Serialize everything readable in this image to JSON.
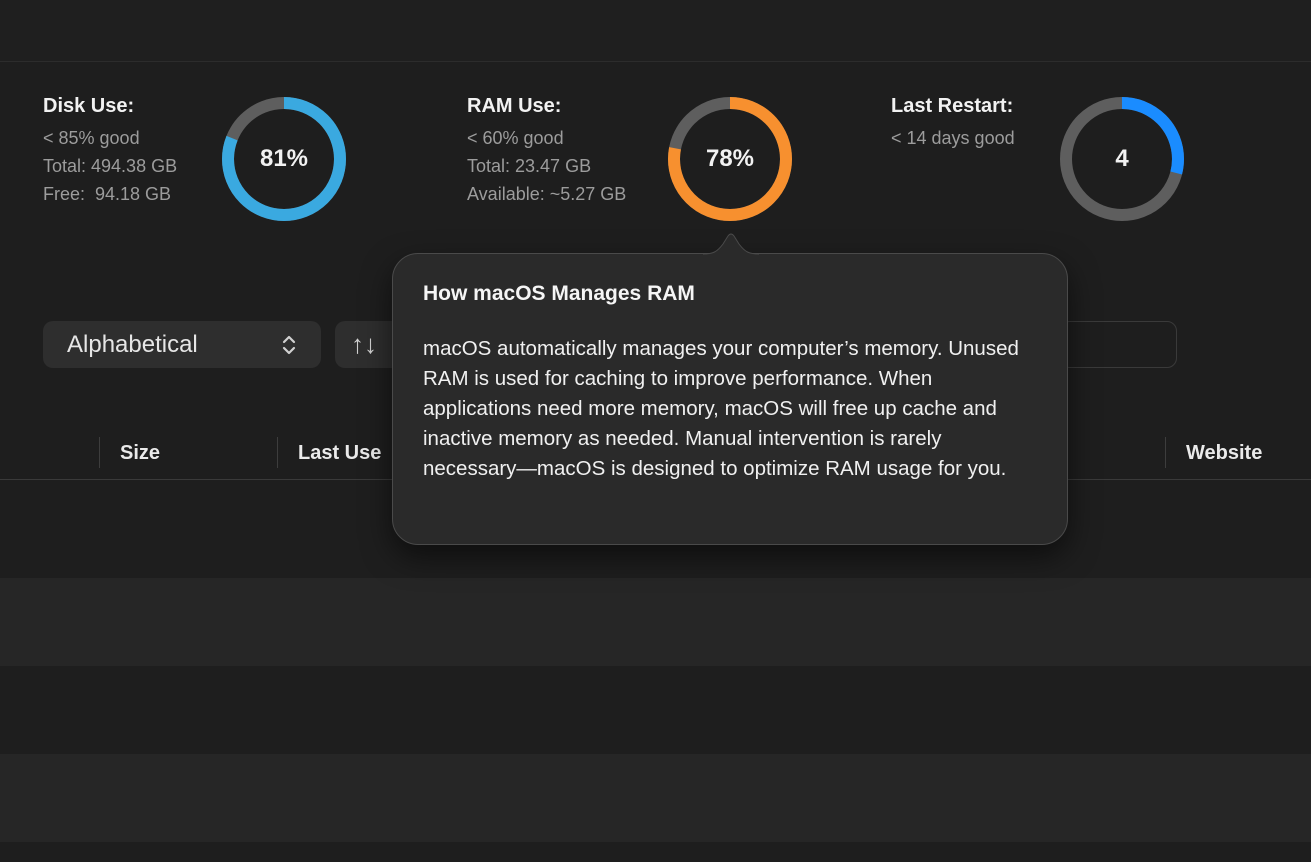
{
  "stats": {
    "disk": {
      "title": "Disk Use:",
      "threshold": "< 85% good",
      "total": "Total: 494.38 GB",
      "free": "Free:  94.18 GB",
      "percent_label": "81%",
      "fraction": 0.81,
      "color": "#3aa9e0"
    },
    "ram": {
      "title": "RAM Use:",
      "threshold": "< 60% good",
      "total": "Total: 23.47 GB",
      "available": "Available: ~5.27 GB",
      "percent_label": "78%",
      "fraction": 0.78,
      "color": "#f7902f"
    },
    "restart": {
      "title": "Last Restart:",
      "threshold": "< 14 days good",
      "value_label": "4",
      "fraction": 0.29,
      "color": "#1a8cff"
    },
    "ring_track_color": "#5e5e5e"
  },
  "toolbar": {
    "sort_dropdown": {
      "selected": "Alphabetical",
      "icon": "chevron-updown-icon"
    },
    "sort_order_button": {
      "glyph": "↑↓",
      "icon": "sort-order-icon"
    },
    "search": {
      "placeholder": ""
    }
  },
  "table": {
    "columns": [
      "Size",
      "Last Use",
      "Website"
    ]
  },
  "popover": {
    "title": "How macOS Manages RAM",
    "body": "macOS automatically manages your computer’s memory. Unused RAM is used for caching to improve performance. When applications need more memory, macOS will free up cache and inactive memory as needed. Manual intervention is rarely necessary—macOS is designed to optimize RAM usage for you."
  }
}
